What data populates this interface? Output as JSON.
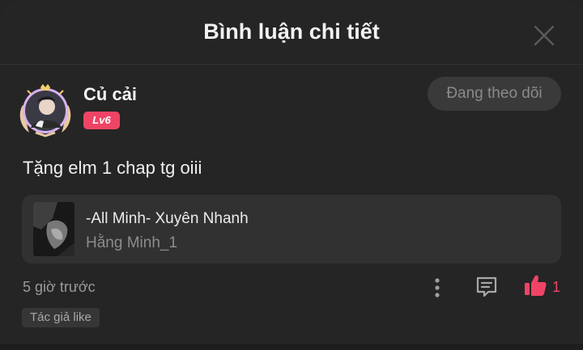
{
  "header": {
    "title": "Bình luận chi tiết"
  },
  "comment": {
    "username": "Củ cải",
    "level": "Lv6",
    "follow_label": "Đang theo dõi",
    "text": "Tặng elm 1 chap tg oiii",
    "time": "5 giờ trước",
    "like_count": "1",
    "author_like_tag": "Tác giả like"
  },
  "book": {
    "title": "-All Minh- Xuyên Nhanh",
    "author": "Hằng Minh_1"
  },
  "icons": {
    "close": "close-icon",
    "more": "more-vertical-icon",
    "reply": "comment-icon",
    "like": "thumbs-up-icon"
  },
  "colors": {
    "accent": "#ef4466",
    "background": "#252525",
    "card": "#313131"
  }
}
